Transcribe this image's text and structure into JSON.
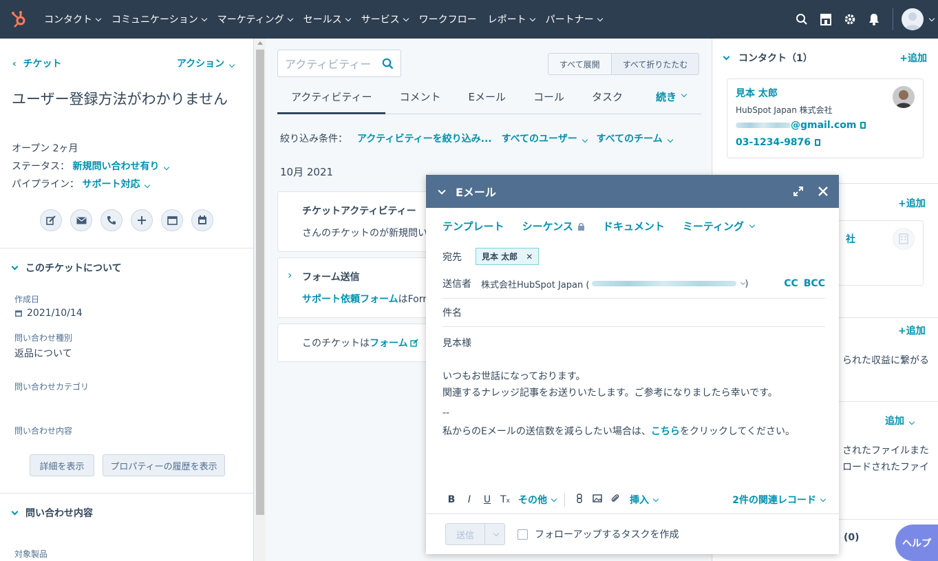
{
  "topnav": {
    "items": [
      "コンタクト",
      "コミュニケーション",
      "マーケティング",
      "セールス",
      "サービス",
      "ワークフロー",
      "レポート",
      "パートナー"
    ],
    "has_caret": [
      true,
      true,
      true,
      true,
      true,
      false,
      true,
      true
    ]
  },
  "left": {
    "back_label": "チケット",
    "actions_label": "アクション",
    "ticket_title": "ユーザー登録方法がわかりません",
    "open_label": "オープン 2ヶ月",
    "status_label": "ステータス：",
    "status_value": "新規問い合わせ有り",
    "pipeline_label": "パイプライン：",
    "pipeline_value": "サポート対応",
    "about_section": "このチケットについて",
    "created_label": "作成日",
    "created_value": "2021/10/14",
    "type_label": "問い合わせ種別",
    "type_value": "返品について",
    "category_label": "問い合わせカテゴリ",
    "content_label": "問い合わせ内容",
    "details_button": "詳細を表示",
    "history_button": "プロパティーの履歴を表示",
    "inquiry_section": "問い合わせ内容",
    "product_label": "対象製品"
  },
  "middle": {
    "search_placeholder": "アクティビティー",
    "expand_all": "すべて展開",
    "collapse_all": "すべて折りたたむ",
    "tabs": [
      "アクティビティー",
      "コメント",
      "Eメール",
      "コール",
      "タスク"
    ],
    "tab_more": "続き",
    "filter_label": "絞り込み条件：",
    "filter_activity": "アクティビティーを絞り込み...",
    "filter_users": "すべてのユーザー",
    "filter_teams": "すべてのチーム",
    "month": "10月 2021",
    "card1_title": "チケットアクティビティー",
    "card1_text": "さんのチケットのが新規問い",
    "card2_title": "フォーム送信",
    "card2_link": "サポート依頼フォーム",
    "card2_text": "はForm",
    "card3_prefix": "このチケットは",
    "card3_link": "フォーム"
  },
  "right": {
    "contact_header": "コンタクト（1）",
    "add_label": "+追加",
    "contact_name": "見本 太郎",
    "contact_company": "HubSpot Japan 株式会社",
    "contact_email_suffix": "@gmail.com",
    "contact_phone": "03-1234-9876",
    "company_link_fragment": "社",
    "revenue_text": "られた収益に繋がる",
    "add_dropdown": "追加",
    "files_text_1": "されたファイルまた",
    "files_text_2": "ロードされたファイ",
    "count_text": "(0)"
  },
  "modal": {
    "title": "Eメール",
    "toolbar": [
      "テンプレート",
      "シーケンス",
      "ドキュメント",
      "ミーティング"
    ],
    "to_label": "宛先",
    "to_recipient": "見本 太郎",
    "from_label": "送信者",
    "from_value": "株式会社HubSpot Japan (",
    "from_close": ")",
    "cc": "CC",
    "bcc": "BCC",
    "subject_label": "件名",
    "body_greeting": "見本様",
    "body_line1": "いつもお世話になっております。",
    "body_line2": "関連するナレッジ記事をお送りいたします。ご参考になりましたら幸いです。",
    "body_sig": "--",
    "body_unsub_pre": "私からのEメールの送信数を減らしたい場合は、",
    "body_unsub_link": "こちら",
    "body_unsub_post": "をクリックしてください。",
    "editor_more": "その他",
    "editor_insert": "挿入",
    "related_records": "2件の関連レコード",
    "send_label": "送信",
    "followup_label": "フォローアップするタスクを作成"
  },
  "help_label": "ヘルプ",
  "colors": {
    "nav_bg": "#2d3e50",
    "link": "#0091ae",
    "hubspot_orange": "#ff7a59",
    "modal_header": "#516f90",
    "help": "#7b89e6"
  }
}
